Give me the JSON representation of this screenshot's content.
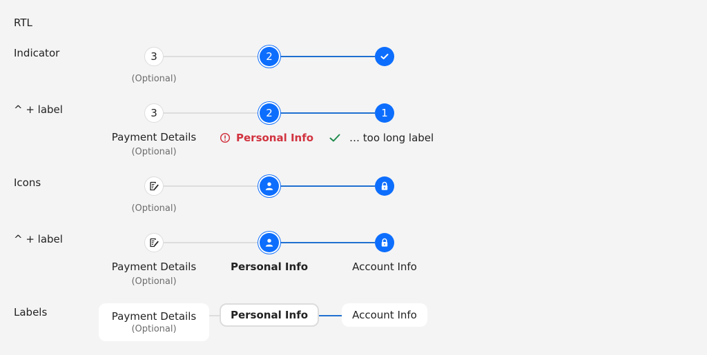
{
  "section_title": "RTL",
  "rows": {
    "indicator": {
      "label": "Indicator",
      "step1": "3",
      "step2": "2",
      "optional": "(Optional)"
    },
    "indicator_label": {
      "label": "^ + label",
      "step1": "3",
      "step2": "2",
      "step3": "1",
      "s1_label": "Payment Details",
      "s1_optional": "(Optional)",
      "s2_label": "Personal Info",
      "s3_label": "… too long label"
    },
    "icons": {
      "label": "Icons",
      "optional": "(Optional)"
    },
    "icons_label": {
      "label": "^ + label",
      "s1_label": "Payment Details",
      "s1_optional": "(Optional)",
      "s2_label": "Personal Info",
      "s3_label": "Account Info"
    },
    "labels": {
      "label": "Labels",
      "s1_label": "Payment Details",
      "s1_optional": "(Optional)",
      "s2_label": "Personal Info",
      "s3_label": "Account Info"
    }
  },
  "colors": {
    "accent": "#0d6efd",
    "line_active": "#1f6fd1",
    "error": "#d1333f",
    "success": "#1e8a4c"
  },
  "icons": {
    "step1": "edit-document-icon",
    "step2": "person-icon",
    "step3": "lock-icon",
    "done": "check-icon",
    "error": "error-circle-icon",
    "success": "checkmark-icon"
  }
}
